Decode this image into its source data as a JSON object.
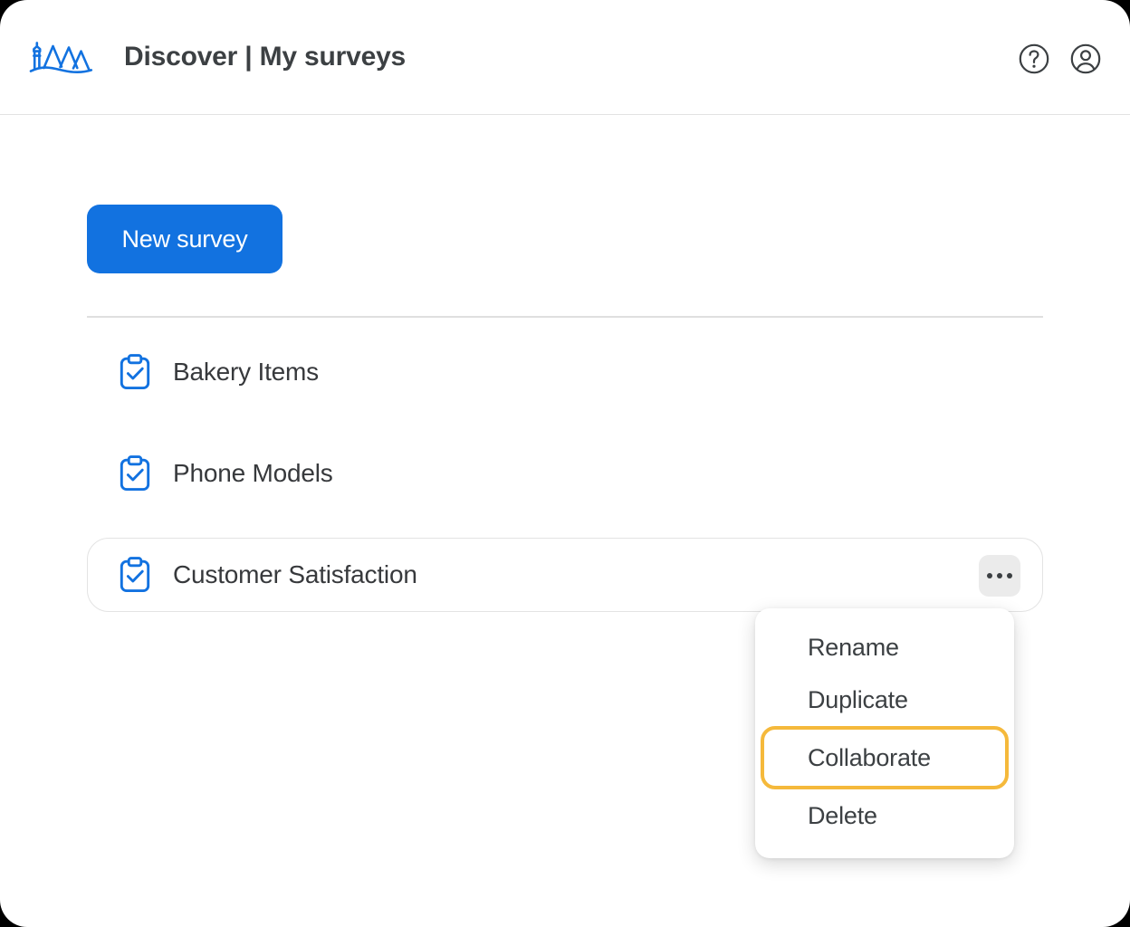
{
  "header": {
    "logo_icon": "mountains-lighthouse-logo",
    "title": "Discover | My surveys",
    "help_icon": "help-circle-icon",
    "account_icon": "account-circle-icon"
  },
  "main": {
    "new_survey_label": "New survey",
    "surveys": [
      {
        "label": "Bakery Items",
        "icon": "clipboard-check-icon",
        "selected": false
      },
      {
        "label": "Phone Models",
        "icon": "clipboard-check-icon",
        "selected": false
      },
      {
        "label": "Customer Satisfaction",
        "icon": "clipboard-check-icon",
        "selected": true
      }
    ],
    "row_menu_icon": "more-horizontal-icon"
  },
  "context_menu": {
    "items": [
      {
        "label": "Rename",
        "highlighted": false
      },
      {
        "label": "Duplicate",
        "highlighted": false
      },
      {
        "label": "Collaborate",
        "highlighted": true
      },
      {
        "label": "Delete",
        "highlighted": false
      }
    ]
  },
  "colors": {
    "brand_blue": "#1272E0",
    "highlight_amber": "#F5B93B",
    "text_primary": "#3c4043",
    "divider": "#dfdfdf",
    "row_border": "#e3e3e3",
    "menu_button_bg": "#ebebeb"
  }
}
